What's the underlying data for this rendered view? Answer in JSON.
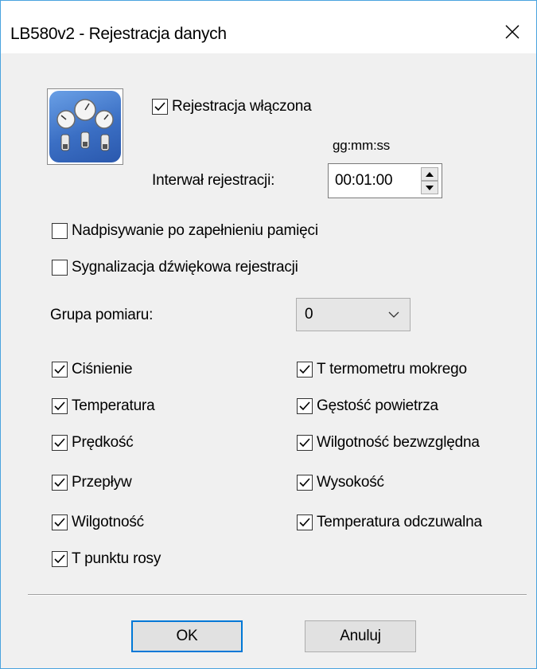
{
  "window": {
    "title": "LB580v2 - Rejestracja danych",
    "close_icon": "×"
  },
  "logging": {
    "enabled_label": "Rejestracja włączona",
    "enabled": true,
    "time_format_hint": "gg:mm:ss",
    "interval_label": "Interwał rejestracji:",
    "interval_value": "00:01:00"
  },
  "options": {
    "overwrite_label": "Nadpisywanie po zapełnieniu pamięci",
    "overwrite": false,
    "sound_label": "Sygnalizacja dźwiękowa rejestracji",
    "sound": false
  },
  "group": {
    "label": "Grupa pomiaru:",
    "value": "0"
  },
  "measurements": {
    "left": [
      {
        "label": "Ciśnienie",
        "checked": true
      },
      {
        "label": "Temperatura",
        "checked": true
      },
      {
        "label": "Prędkość",
        "checked": true
      },
      {
        "label": "Przepływ",
        "checked": true
      },
      {
        "label": "Wilgotność",
        "checked": true
      },
      {
        "label": "T punktu rosy",
        "checked": true
      }
    ],
    "right": [
      {
        "label": "T termometru mokrego",
        "checked": true
      },
      {
        "label": "Gęstość powietrza",
        "checked": true
      },
      {
        "label": "Wilgotność bezwzględna",
        "checked": true
      },
      {
        "label": "Wysokość",
        "checked": true
      },
      {
        "label": "Temperatura odczuwalna",
        "checked": true
      }
    ]
  },
  "buttons": {
    "ok_label": "OK",
    "cancel_label": "Anuluj"
  },
  "colors": {
    "accent": "#0078d7",
    "window_border": "#4aa3df",
    "dialog_bg": "#f0f0f0"
  }
}
